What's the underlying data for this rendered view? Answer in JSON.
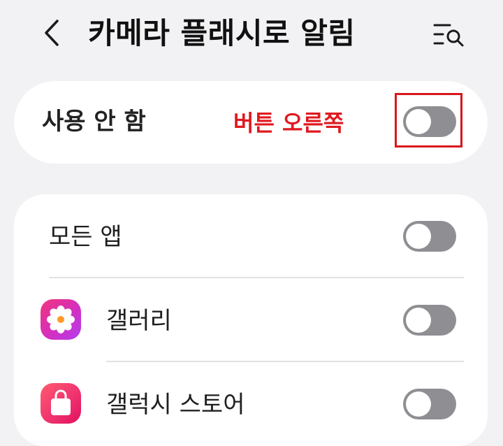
{
  "header": {
    "title": "카메라 플래시로 알림"
  },
  "master": {
    "label": "사용 안 함",
    "annotation": "버튼 오른쪽",
    "toggle_state": "off"
  },
  "apps": [
    {
      "label": "모든 앱",
      "icon": "none",
      "toggle_state": "off"
    },
    {
      "label": "갤러리",
      "icon": "gallery-flower-icon",
      "toggle_state": "off"
    },
    {
      "label": "갤럭시 스토어",
      "icon": "shopping-bag-icon",
      "toggle_state": "off"
    }
  ],
  "colors": {
    "background": "#f2f2f4",
    "card": "#ffffff",
    "toggle_off": "#8e8e93",
    "annotation_red": "#e0191f",
    "gallery_icon_start": "#f2357a",
    "gallery_icon_end": "#b23cf0",
    "store_icon_start": "#ff5b6e",
    "store_icon_end": "#e0105e"
  }
}
